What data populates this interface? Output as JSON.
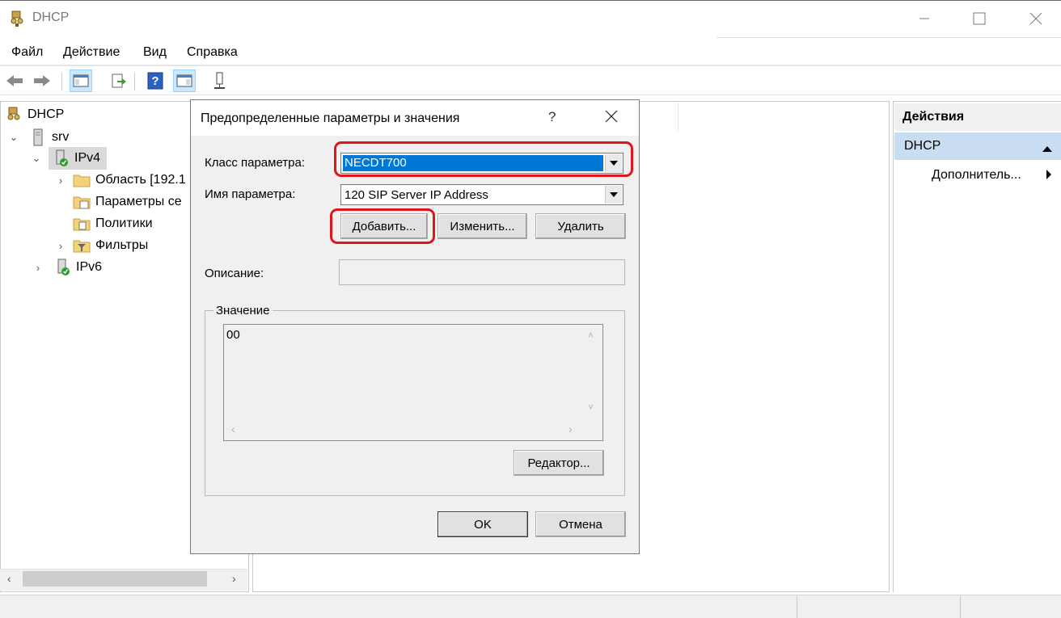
{
  "window": {
    "title": "DHCP"
  },
  "menu": {
    "items": [
      "Файл",
      "Действие",
      "Вид",
      "Справка"
    ]
  },
  "toolbar": {
    "buttons": [
      "back-icon",
      "forward-icon",
      "show-hide-tree-icon",
      "export-list-icon",
      "help-icon",
      "show-hide-action-pane-icon",
      "server-status-icon"
    ]
  },
  "tree": {
    "root": "DHCP",
    "server": "srv",
    "ipv4": "IPv4",
    "scope": "Область [192.1",
    "server_options": "Параметры се",
    "policies": "Политики",
    "filters": "Фильтры",
    "ipv6": "IPv6"
  },
  "actions": {
    "header": "Действия",
    "section": "DHCP",
    "more": "Дополнитель..."
  },
  "dialog": {
    "title": "Предопределенные параметры и значения",
    "help": "?",
    "class_label": "Класс параметра:",
    "class_value": "NECDT700",
    "name_label": "Имя параметра:",
    "name_value": "120 SIP Server IP Address",
    "add_button": "Добавить...",
    "edit_button": "Изменить...",
    "delete_button": "Удалить",
    "description_label": "Описание:",
    "description_value": "",
    "value_group": "Значение",
    "value_text": "00",
    "editor_button": "Редактор...",
    "ok_button": "OK",
    "cancel_button": "Отмена"
  },
  "colors": {
    "highlight_red": "#e0141b",
    "selection_blue": "#0078d7",
    "actions_selected": "#c8ddf2"
  }
}
